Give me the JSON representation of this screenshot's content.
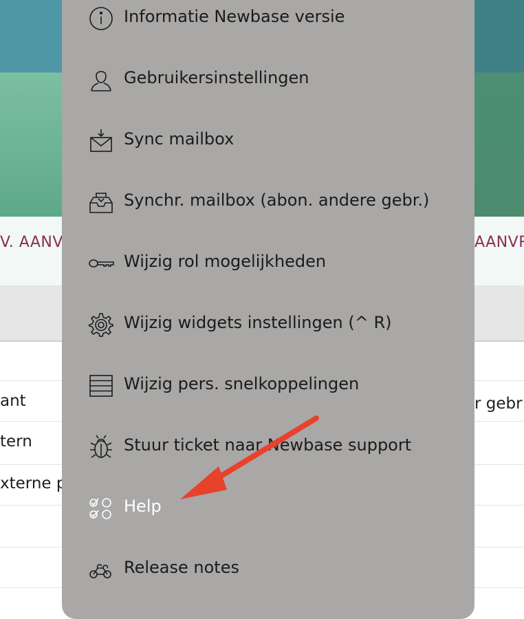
{
  "background": {
    "tab_left": "V. AANV",
    "tab_right": "AANVR",
    "rows": [
      {
        "left": "",
        "right": ""
      },
      {
        "left": "ant",
        "right": "r gebr"
      },
      {
        "left": "tern",
        "right": ""
      },
      {
        "left": "xterne p",
        "right": ""
      },
      {
        "left": "",
        "right": ""
      },
      {
        "left": "",
        "right": ""
      }
    ]
  },
  "menu": {
    "items": [
      {
        "label": "Informatie Newbase versie",
        "icon": "info-icon"
      },
      {
        "label": "Gebruikersinstellingen",
        "icon": "user-icon"
      },
      {
        "label": "Sync mailbox",
        "icon": "mail-download-icon"
      },
      {
        "label": "Synchr. mailbox (abon. andere gebr.)",
        "icon": "inbox-tray-icon"
      },
      {
        "label": "Wijzig rol mogelijkheden",
        "icon": "key-icon"
      },
      {
        "label": "Wijzig widgets instellingen (^ R)",
        "icon": "gear-icon"
      },
      {
        "label": "Wijzig pers. snelkoppelingen",
        "icon": "stacked-bars-icon"
      },
      {
        "label": "Stuur ticket naar Newbase support",
        "icon": "bug-icon"
      },
      {
        "label": "Help",
        "icon": "checklist-icon"
      },
      {
        "label": "Release notes",
        "icon": "bike-icon"
      }
    ]
  },
  "colors": {
    "menu_bg": "#a9a8a7",
    "tab_text": "#8a2d56",
    "arrow": "#e8412c"
  }
}
